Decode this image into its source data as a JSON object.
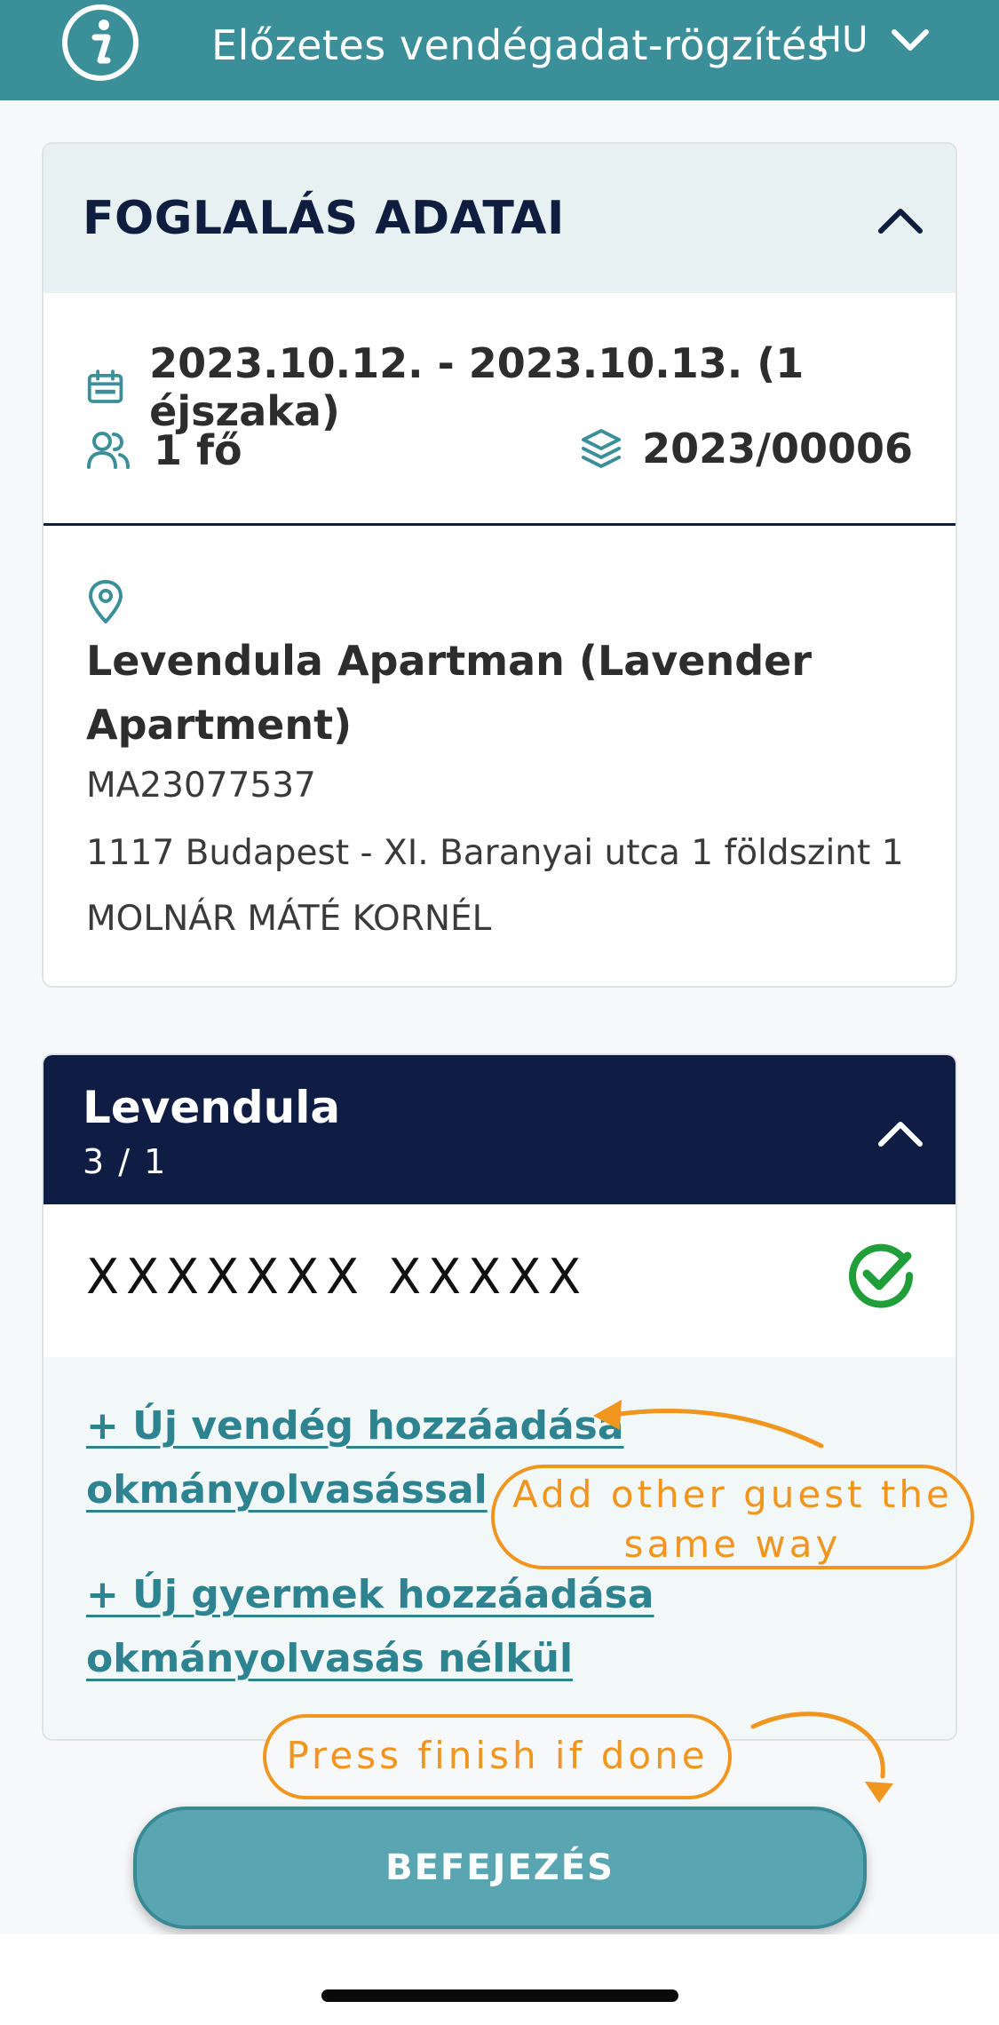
{
  "topbar": {
    "title": "Előzetes vendégadat-rögzítés",
    "language": "HU",
    "info_icon": "info-circle-icon",
    "lang_icon": "chevron-down-icon",
    "bg_color": "#3a8f99"
  },
  "booking": {
    "title": "FOGLALÁS ADATAI",
    "dates": "2023.10.12. - 2023.10.13. (1 éjszaka)",
    "persons": "1 fő",
    "booking_number": "2023/00006",
    "apartment": {
      "name": "Levendula Apartman (Lavender Apartment)",
      "code": "MA23077537",
      "address": "1117 Budapest - XI. Baranyai utca 1 földszint 1",
      "owner": "MOLNÁR MÁTÉ KORNÉL"
    }
  },
  "room": {
    "title": "Levendula",
    "subtitle": "3 / 1",
    "guest_name": "XXXXXXX XXXXX",
    "guest_status_icon": "check-circle-icon",
    "add_guest_link": "+ Új vendég hozzáadása okmányolvasással",
    "add_child_link": "+ Új gyermek hozzáadása okmányolvasás nélkül"
  },
  "annotations": {
    "add_guest_note": "Add other guest the same way",
    "finish_note": "Press finish if done",
    "color": "#f0951e"
  },
  "finish_button": {
    "label": "BEFEJEZÉS"
  }
}
